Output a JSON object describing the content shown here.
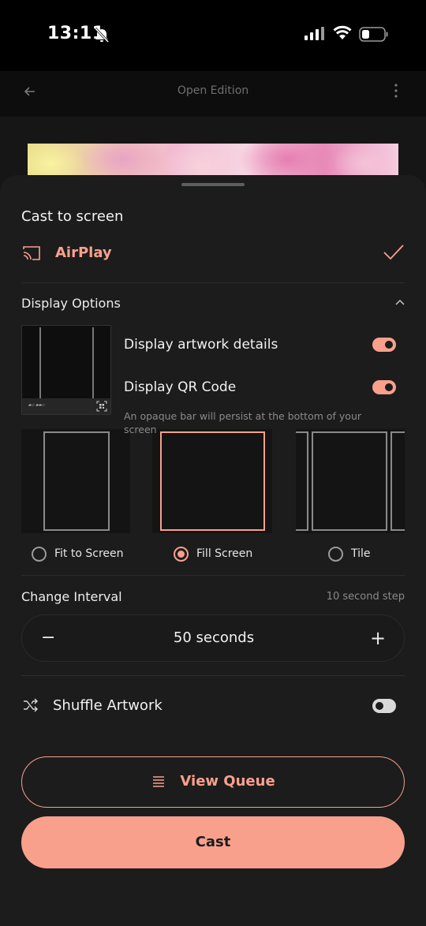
{
  "status_bar": {
    "time": "13:11",
    "icons": [
      "bell-slash-icon",
      "cellular-signal-icon",
      "wifi-icon",
      "battery-icon"
    ]
  },
  "app_header": {
    "title": "Open Edition",
    "back_icon": "arrow-left-icon",
    "menu_icon": "more-vertical-icon"
  },
  "sheet": {
    "title": "Cast to screen",
    "device": {
      "label": "AirPlay",
      "icon": "cast-icon",
      "selected": true
    },
    "display_options": {
      "title": "Display Options",
      "expanded": true,
      "toggles": [
        {
          "label": "Display artwork details",
          "on": true
        },
        {
          "label": "Display QR Code",
          "on": true
        }
      ],
      "helper": "An opaque bar will persist at the bottom of your screen",
      "layouts": [
        {
          "label": "Fit to Screen",
          "selected": false
        },
        {
          "label": "Fill Screen",
          "selected": true
        },
        {
          "label": "Tile",
          "selected": false
        }
      ]
    },
    "interval": {
      "title": "Change Interval",
      "step": "10 second step",
      "value": "50 seconds",
      "minus": "−",
      "plus": "+"
    },
    "shuffle": {
      "label": "Shuffle Artwork",
      "on": false
    },
    "queue_button": "View Queue",
    "cast_button": "Cast"
  },
  "colors": {
    "accent": "#f9a08d",
    "sheet_bg": "#1c1c1c",
    "text": "#f2f2f2",
    "muted": "#8a8a8a"
  }
}
